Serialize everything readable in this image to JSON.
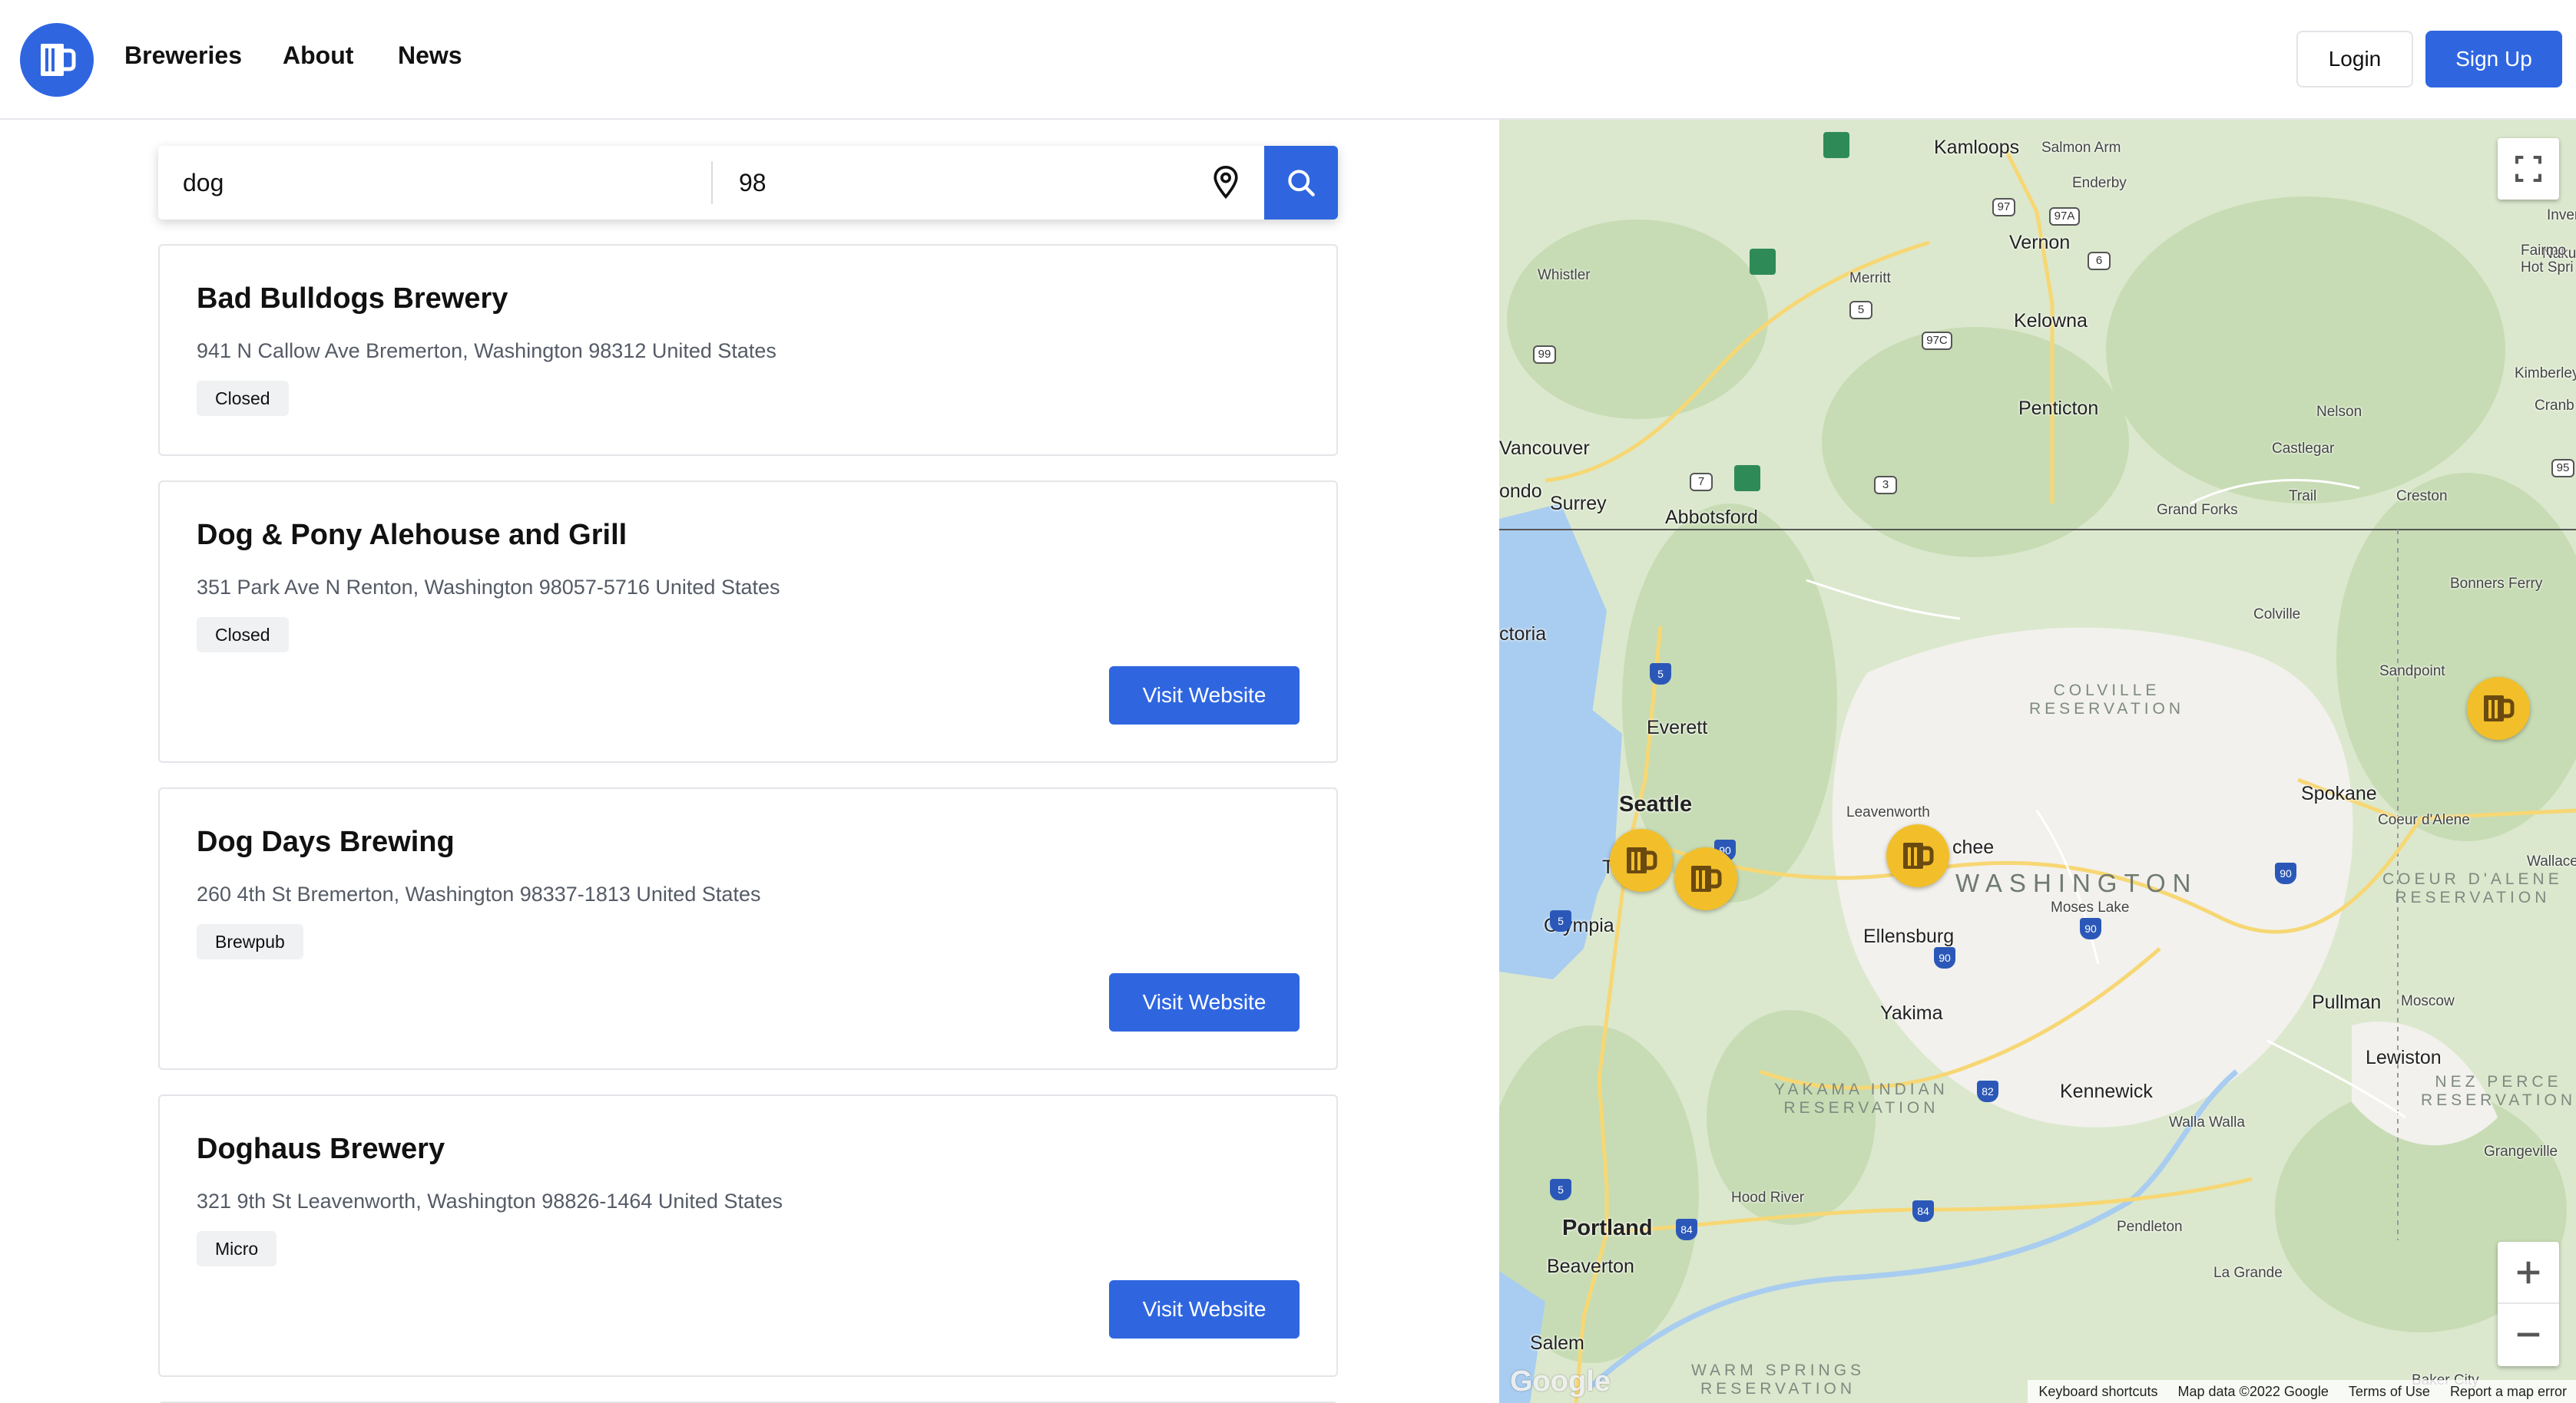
{
  "header": {
    "nav": [
      "Breweries",
      "About",
      "News"
    ],
    "login_label": "Login",
    "signup_label": "Sign Up"
  },
  "search": {
    "query_value": "dog",
    "location_value": "98"
  },
  "results": [
    {
      "name": "Bad Bulldogs Brewery",
      "address": "941 N Callow Ave Bremerton, Washington 98312 United States",
      "type": "Closed",
      "has_website": false
    },
    {
      "name": "Dog & Pony Alehouse and Grill",
      "address": "351 Park Ave N Renton, Washington 98057-5716 United States",
      "type": "Closed",
      "has_website": true
    },
    {
      "name": "Dog Days Brewing",
      "address": "260 4th St Bremerton, Washington 98337-1813 United States",
      "type": "Brewpub",
      "has_website": true
    },
    {
      "name": "Doghaus Brewery",
      "address": "321 9th St Leavenworth, Washington 98826-1464 United States",
      "type": "Micro",
      "has_website": true
    }
  ],
  "visit_label": "Visit Website",
  "map": {
    "cities": {
      "kamloops": "Kamloops",
      "kelowna": "Kelowna",
      "vernon": "Vernon",
      "penticton": "Penticton",
      "vancouver": "Vancouver",
      "surrey": "Surrey",
      "abbotsford": "Abbotsford",
      "victoria": "ctoria",
      "everett": "Everett",
      "seattle": "Seattle",
      "olympia": "Olympia",
      "spokane": "Spokane",
      "yakima": "Yakima",
      "kennewick": "Kennewick",
      "portland": "Portland",
      "beaverton": "Beaverton",
      "salem": "Salem",
      "pullman": "Pullman",
      "lewiston": "Lewiston",
      "ellensburg": "Ellensburg",
      "wenatchee": "chee",
      "tacoma": "Ta"
    },
    "towns": {
      "salmon_arm": "Salmon Arm",
      "enderby": "Enderby",
      "whistler": "Whistler",
      "merritt": "Merritt",
      "nakusp": "Nakusp",
      "invermere": "Invermere",
      "fairmont": "Fairmo",
      "hot_springs": "Hot Spri",
      "kimberley": "Kimberley",
      "cranbrook": "Cranb",
      "nelson": "Nelson",
      "castlegar": "Castlegar",
      "trail": "Trail",
      "creston": "Creston",
      "grand_forks": "Grand Forks",
      "bonners_ferry": "Bonners Ferry",
      "colville": "Colville",
      "sandpoint": "Sandpoint",
      "leavenworth": "Leavenworth",
      "moses_lake": "Moses Lake",
      "coeur_dalene": "Coeur d'Alene",
      "wallace": "Wallace",
      "moscow": "Moscow",
      "walla_walla": "Walla Walla",
      "grangeville": "Grangeville",
      "hood_river": "Hood River",
      "pendleton": "Pendleton",
      "la_grande": "La Grande",
      "baker_city": "Baker City",
      "nanaimo": "ondo"
    },
    "regions": {
      "colville": [
        "COLVILLE",
        "RESERVATION"
      ],
      "yakama": [
        "YAKAMA INDIAN",
        "RESERVATION"
      ],
      "coeur": [
        "COEUR D'ALENE",
        "RESERVATION"
      ],
      "nez": [
        "NEZ PERCE",
        "RESERVATION"
      ],
      "warm": [
        "WARM SPRINGS",
        "RESERVATION"
      ]
    },
    "state_label": "WASHINGTON",
    "highways": [
      "97",
      "97A",
      "6",
      "97C",
      "5",
      "99",
      "3",
      "95",
      "7"
    ],
    "interstates": [
      "5",
      "90",
      "82",
      "84"
    ],
    "google_logo": "Google",
    "footer": [
      "Keyboard shortcuts",
      "Map data ©2022 Google",
      "Terms of Use",
      "Report a map error"
    ],
    "colors": {
      "water": "#a9cdf0",
      "land": "#dbe8cd",
      "urban": "#f2f1ed",
      "marker": "#f2bf2a",
      "road": "#f7d774"
    }
  },
  "colors": {
    "primary": "#2f66e0",
    "badge_bg": "#f0f1f3"
  }
}
